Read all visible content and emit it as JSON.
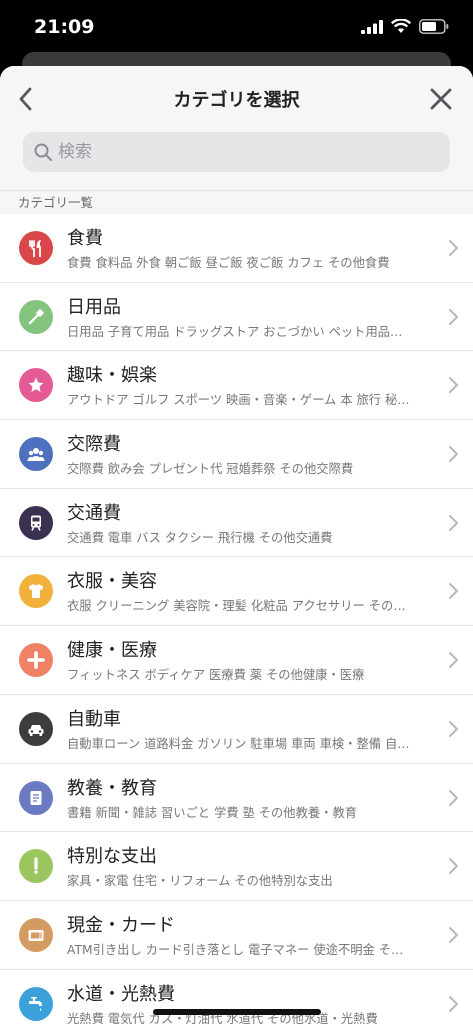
{
  "status": {
    "time": "21:09"
  },
  "header": {
    "title": "カテゴリを選択"
  },
  "search": {
    "placeholder": "検索"
  },
  "section": {
    "label": "カテゴリ一覧"
  },
  "categories": [
    {
      "title": "食費",
      "sub": "食費 食料品 外食 朝ご飯 昼ご飯 夜ご飯 カフェ その他食費",
      "color": "#d9474a",
      "icon": "fork-knife-icon"
    },
    {
      "title": "日用品",
      "sub": "日用品 子育て用品 ドラッグストア おこづかい ペット用品…",
      "color": "#84c47f",
      "icon": "toothbrush-icon"
    },
    {
      "title": "趣味・娯楽",
      "sub": "アウトドア ゴルフ スポーツ 映画・音楽・ゲーム 本 旅行 秘…",
      "color": "#e45a95",
      "icon": "star-icon"
    },
    {
      "title": "交際費",
      "sub": "交際費 飲み会 プレゼント代 冠婚葬祭 その他交際費",
      "color": "#4f6fbf",
      "icon": "people-icon"
    },
    {
      "title": "交通費",
      "sub": "交通費 電車 バス タクシー 飛行機 その他交通費",
      "color": "#3a3050",
      "icon": "train-icon"
    },
    {
      "title": "衣服・美容",
      "sub": "衣服 クリーニング 美容院・理髪 化粧品 アクセサリー その…",
      "color": "#f0b23a",
      "icon": "tshirt-icon"
    },
    {
      "title": "健康・医療",
      "sub": "フィットネス ボディケア 医療費 薬 その他健康・医療",
      "color": "#ee8264",
      "icon": "cross-icon"
    },
    {
      "title": "自動車",
      "sub": "自動車ローン 道路料金 ガソリン 駐車場 車両 車検・整備 自…",
      "color": "#3d3d3f",
      "icon": "car-icon"
    },
    {
      "title": "教養・教育",
      "sub": "書籍 新聞・雑誌 習いごと 学費 塾 その他教養・教育",
      "color": "#6a7bc4",
      "icon": "book-icon"
    },
    {
      "title": "特別な支出",
      "sub": "家具・家電 住宅・リフォーム その他特別な支出",
      "color": "#9bc55f",
      "icon": "exclamation-icon"
    },
    {
      "title": "現金・カード",
      "sub": "ATM引き出し カード引き落とし 電子マネー 使途不明金 そ…",
      "color": "#d39b62",
      "icon": "wallet-icon"
    },
    {
      "title": "水道・光熱費",
      "sub": "光熱費 電気代 ガス・灯油代 水道代 その他水道・光熱費",
      "color": "#3ba1d8",
      "icon": "faucet-icon"
    }
  ]
}
